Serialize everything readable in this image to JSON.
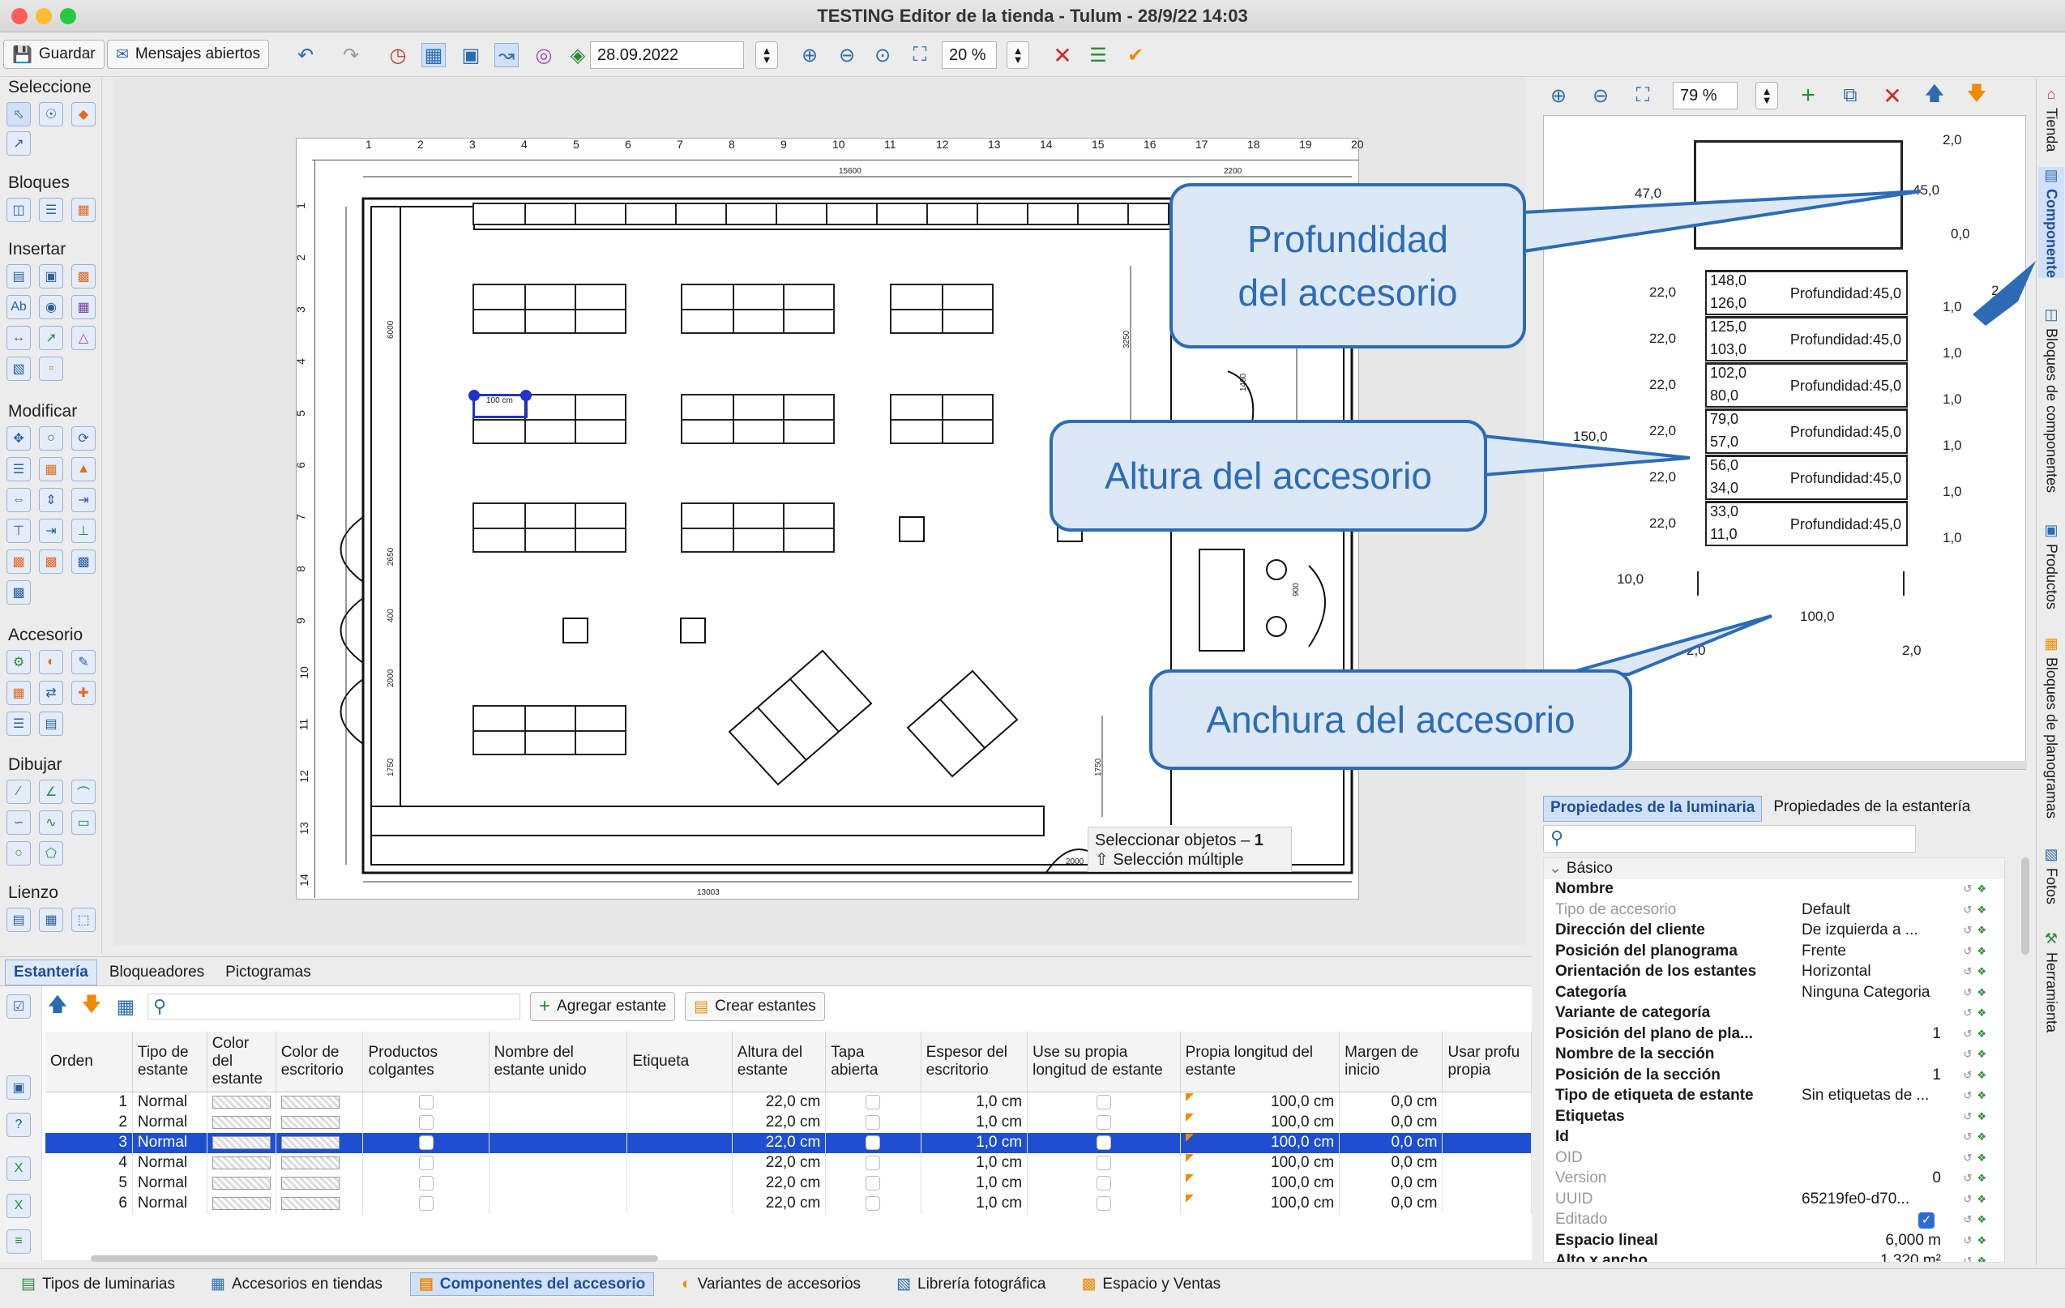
{
  "window": {
    "title": "TESTING Editor de la tienda - Tulum - 28/9/22 14:03"
  },
  "toolbar": {
    "save": "Guardar",
    "messages": "Mensajes abiertos",
    "date": "28.09.2022",
    "zoom": "20 %"
  },
  "palette": {
    "sections": [
      "Seleccione",
      "Bloques",
      "Insertar",
      "Modificar",
      "Accesorio",
      "Dibujar",
      "Lienzo"
    ]
  },
  "canvas": {
    "ruler_h": [
      "1",
      "2",
      "3",
      "4",
      "5",
      "6",
      "7",
      "8",
      "9",
      "10",
      "11",
      "12",
      "13",
      "14",
      "15",
      "16",
      "17",
      "18",
      "19",
      "20"
    ],
    "ruler_v": [
      "1",
      "2",
      "3",
      "4",
      "5",
      "6",
      "7",
      "8",
      "9",
      "10",
      "11",
      "12",
      "13",
      "14"
    ],
    "dims": {
      "top": "15600",
      "top_right": "2200",
      "bottom": "13003",
      "bottom_right": "2000",
      "left_a": "6000",
      "left_b": "2650",
      "left_c": "400",
      "left_d": "2000",
      "left_e": "1750",
      "mid_a": "3250",
      "mid_b": "1460",
      "right_a": "900",
      "bottom_mid": "1750"
    },
    "selected_label": "100 cm",
    "status_line1": "Seleccionar objetos – ",
    "status_count": "1",
    "status_line2": "⇧ Selección múltiple"
  },
  "bottom": {
    "tabs": [
      "Estantería",
      "Bloqueadores",
      "Pictogramas"
    ],
    "add_shelf": "Agregar estante",
    "create_shelves": "Crear estantes",
    "columns": [
      "Orden",
      "Tipo de estante",
      "Color del estante",
      "Color de escritorio",
      "Productos colgantes",
      "Nombre del estante unido",
      "Etiqueta",
      "Altura del estante",
      "Tapa abierta",
      "Espesor del escritorio",
      "Use su propia longitud de estante",
      "Propia longitud del estante",
      "Margen de inicio",
      "Usar profu propia"
    ],
    "rows": [
      {
        "order": "1",
        "type": "Normal",
        "height": "22,0 cm",
        "thickness": "1,0 cm",
        "length": "100,0 cm",
        "margin": "0,0 cm"
      },
      {
        "order": "2",
        "type": "Normal",
        "height": "22,0 cm",
        "thickness": "1,0 cm",
        "length": "100,0 cm",
        "margin": "0,0 cm"
      },
      {
        "order": "3",
        "type": "Normal",
        "height": "22,0 cm",
        "thickness": "1,0 cm",
        "length": "100,0 cm",
        "margin": "0,0 cm"
      },
      {
        "order": "4",
        "type": "Normal",
        "height": "22,0 cm",
        "thickness": "1,0 cm",
        "length": "100,0 cm",
        "margin": "0,0 cm"
      },
      {
        "order": "5",
        "type": "Normal",
        "height": "22,0 cm",
        "thickness": "1,0 cm",
        "length": "100,0 cm",
        "margin": "0,0 cm"
      },
      {
        "order": "6",
        "type": "Normal",
        "height": "22,0 cm",
        "thickness": "1,0 cm",
        "length": "100,0 cm",
        "margin": "0,0 cm"
      }
    ],
    "selected_row": 3
  },
  "bottom_tabs": [
    "Tipos de luminarias",
    "Accesorios en tiendas",
    "Componentes del accesorio",
    "Variantes de accesorios",
    "Librería fotográfica",
    "Espacio y Ventas"
  ],
  "preview": {
    "zoom": "79 %",
    "top_right": "2,0",
    "top_left": "47,0",
    "top_depth": "45,0",
    "top_zero": "0,0",
    "top_two": "2",
    "shelves": [
      {
        "top": "148,0",
        "bottom": "126,0",
        "depth": "Profundidad:45,0",
        "left": "22,0",
        "right": "1,0"
      },
      {
        "top": "125,0",
        "bottom": "103,0",
        "depth": "Profundidad:45,0",
        "left": "22,0",
        "right": "1,0"
      },
      {
        "top": "102,0",
        "bottom": "80,0",
        "depth": "Profundidad:45,0",
        "left": "22,0",
        "right": "1,0"
      },
      {
        "top": "79,0",
        "bottom": "57,0",
        "depth": "Profundidad:45,0",
        "left": "22,0",
        "right": "1,0"
      },
      {
        "top": "56,0",
        "bottom": "34,0",
        "depth": "Profundidad:45,0",
        "left": "22,0",
        "right": "1,0"
      },
      {
        "top": "33,0",
        "bottom": "11,0",
        "depth": "Profundidad:45,0",
        "left": "22,0",
        "right": "1,0"
      }
    ],
    "total_height": "150,0",
    "base": "10,0",
    "width": "100,0",
    "foot_left": "2,0",
    "foot_right": "2,0"
  },
  "callouts": {
    "depth_line1": "Profundidad",
    "depth_line2": "del accesorio",
    "height": "Altura del accesorio",
    "width": "Anchura del accesorio"
  },
  "properties": {
    "tabs": [
      "Propiedades de la luminaria",
      "Propiedades de la estantería"
    ],
    "group": "Básico",
    "rows": [
      {
        "name": "Nombre",
        "value": ""
      },
      {
        "name": "Tipo de accesorio",
        "value": "Default",
        "dim": true
      },
      {
        "name": "Dirección del cliente",
        "value": "De izquierda a ..."
      },
      {
        "name": "Posición del planograma",
        "value": "Frente"
      },
      {
        "name": "Orientación de los estantes",
        "value": "Horizontal"
      },
      {
        "name": "Categoría",
        "value": "Ninguna Categoria"
      },
      {
        "name": "Variante de categoría",
        "value": ""
      },
      {
        "name": "Posición del plano de pla...",
        "value": "1",
        "right": true
      },
      {
        "name": "Nombre de la sección",
        "value": ""
      },
      {
        "name": "Posición de la sección",
        "value": "1",
        "right": true
      },
      {
        "name": "Tipo de etiqueta de estante",
        "value": "Sin etiquetas de ..."
      },
      {
        "name": "Etiquetas",
        "value": ""
      },
      {
        "name": "Id",
        "value": ""
      },
      {
        "name": "OID",
        "value": "",
        "dim": true
      },
      {
        "name": "Version",
        "value": "0",
        "dim": true,
        "right": true
      },
      {
        "name": "UUID",
        "value": "65219fe0-d70...",
        "dim": true
      },
      {
        "name": "Editado",
        "value": "",
        "dim": true,
        "check": true
      },
      {
        "name": "Espacio lineal",
        "value": "6,000 m",
        "right": true
      },
      {
        "name": "Alto x ancho",
        "value": "1,320 m²",
        "right": true
      }
    ]
  },
  "side_tabs": [
    "Tienda",
    "Componente",
    "Bloques de componentes",
    "Productos",
    "Bloques de planogramas",
    "Fotos",
    "Herramienta"
  ],
  "colors": {
    "accent": "#2d6cb5",
    "selection": "#1d4fd0",
    "callout_bg": "#dce8f6"
  }
}
